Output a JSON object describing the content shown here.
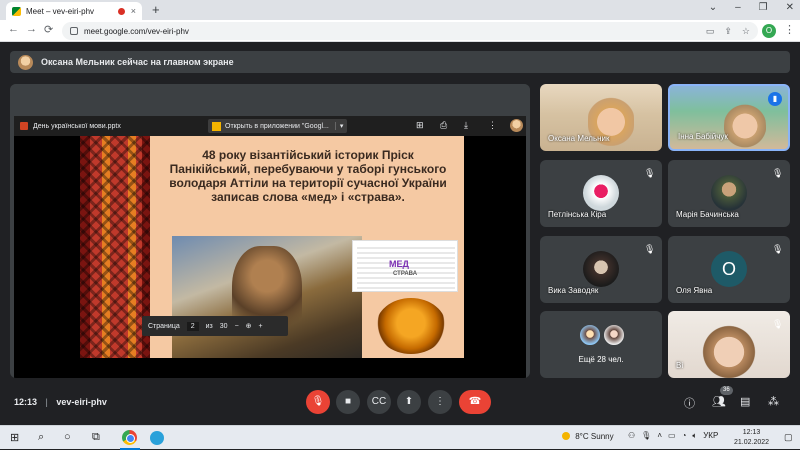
{
  "browser": {
    "tab_title": "Meet – vev-eiri-phv",
    "tab_close": "×",
    "new_tab": "+",
    "window_controls": [
      "⌄",
      "–",
      "❐",
      "✕"
    ],
    "nav": {
      "back": "←",
      "forward": "→",
      "reload": "⟳"
    },
    "url": "meet.google.com/vev-eiri-phv",
    "profile_initial": "O",
    "menu": "⋮"
  },
  "banner": {
    "text": "Оксана Мельник сейчас на главном экране"
  },
  "viewer": {
    "filename": "День української мови.pptx",
    "open_with": "Открыть в приложении \"Googl...",
    "open_caret": "▾",
    "icons": [
      "comment-icon",
      "print-icon",
      "download-icon",
      "more-icon"
    ]
  },
  "slide": {
    "text": "48 року візантійський історик Пріск Панікійський, перебуваючи у таборі гунського володаря Аттіли на території сучасної України записав слова «мед» і «страва».",
    "wordcloud_main": "МЕД",
    "wordcloud_sub": "СТРАВА"
  },
  "pager": {
    "label": "Страница",
    "current": "2",
    "of": "из",
    "total": "30",
    "minus": "−",
    "plus": "+"
  },
  "participants": [
    {
      "name": "Оксана Мельник"
    },
    {
      "name": "Інна Бабійчук"
    },
    {
      "name": "Петлінська Кіра"
    },
    {
      "name": "Марія Бачинська"
    },
    {
      "name": "Вика Заводяк"
    },
    {
      "name": "Оля Явна",
      "initial": "О"
    },
    {
      "name": "Ещё 28 чел."
    },
    {
      "name": "Ві"
    }
  ],
  "meeting": {
    "time": "12:13",
    "separator": "|",
    "code": "vev-eiri-phv",
    "participant_count": "36",
    "accent_red": "#ea4335"
  },
  "taskbar": {
    "temperature": "8°C",
    "weather": "Sunny",
    "lang": "УКР",
    "time": "12:13",
    "date": "21.02.2022"
  }
}
